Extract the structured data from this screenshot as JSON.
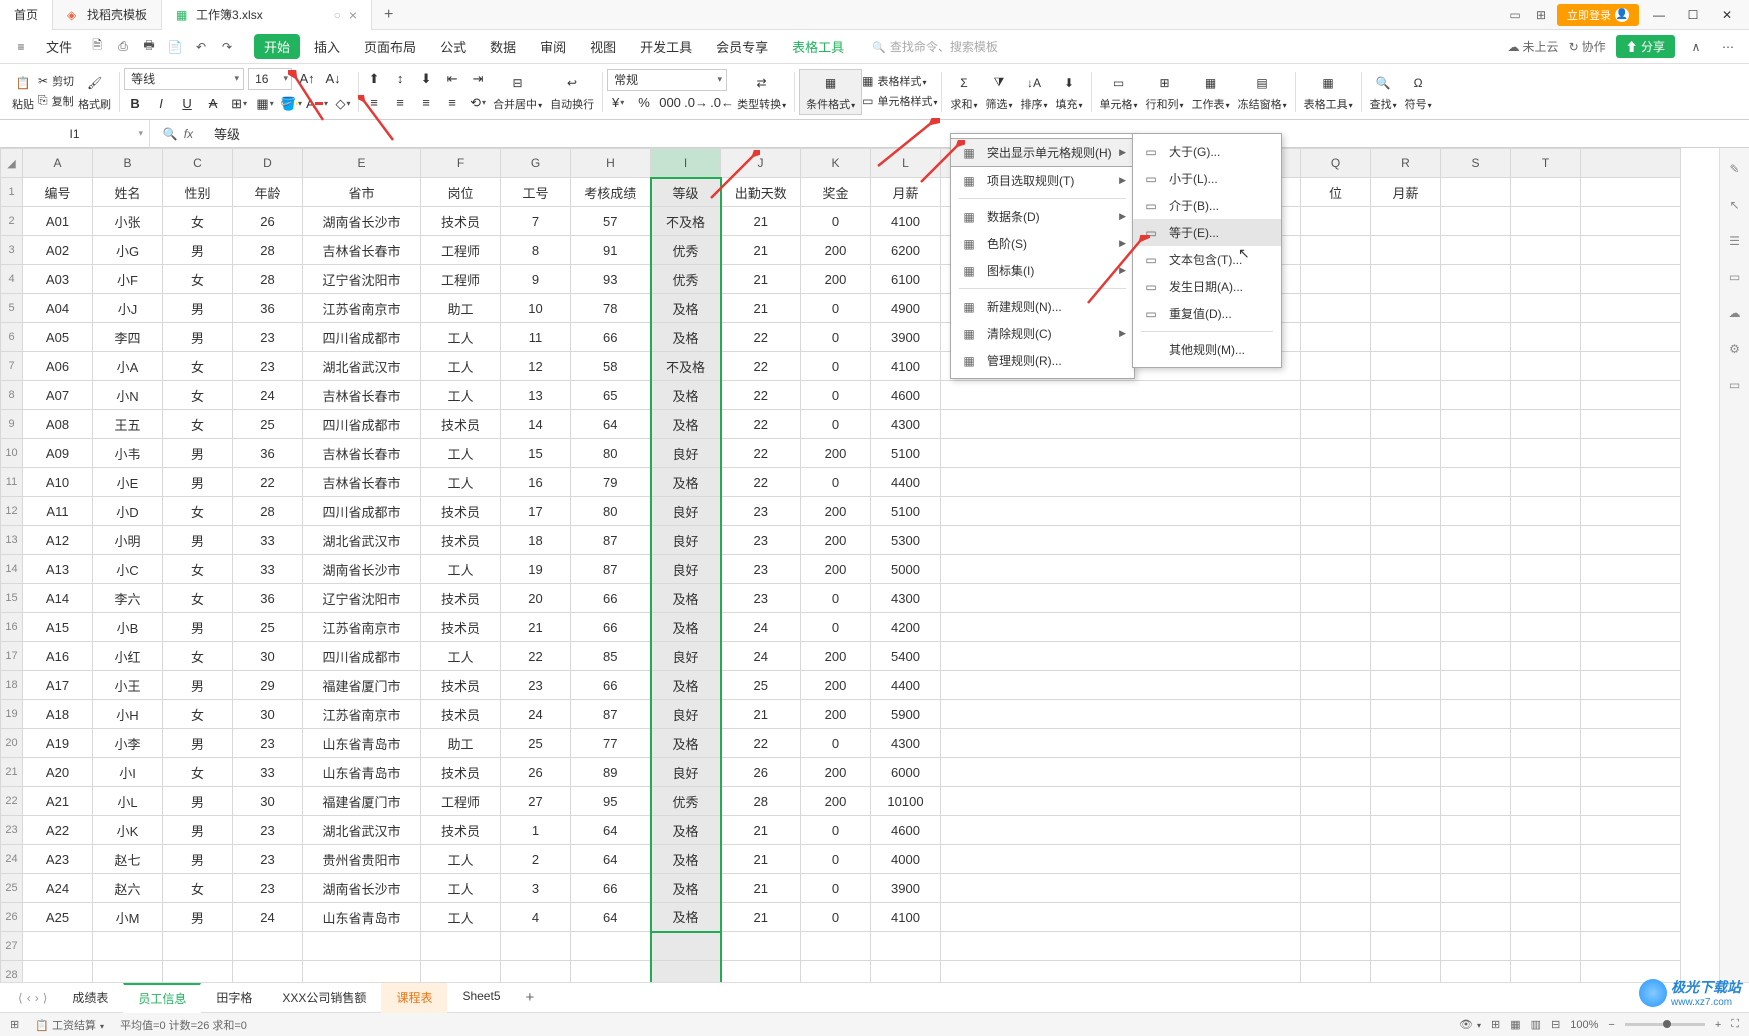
{
  "titlebar": {
    "tabs": [
      {
        "label": "首页",
        "icon": "home",
        "active": false
      },
      {
        "label": "找稻壳模板",
        "icon": "template",
        "active": false
      },
      {
        "label": "工作簿3.xlsx",
        "icon": "spreadsheet",
        "active": true
      }
    ],
    "login_label": "立即登录"
  },
  "menubar": {
    "file_label": "文件",
    "items": [
      "开始",
      "插入",
      "页面布局",
      "公式",
      "数据",
      "审阅",
      "视图",
      "开发工具",
      "会员专享",
      "表格工具"
    ],
    "active_index": 0,
    "search_placeholder": "查找命令、搜索模板",
    "cloud_label": "未上云",
    "coop_label": "协作",
    "share_label": "分享"
  },
  "ribbon": {
    "paste": "粘贴",
    "cut": "剪切",
    "copy": "复制",
    "format_painter": "格式刷",
    "font_name": "等线",
    "font_size": "16",
    "merge_center": "合并居中",
    "auto_wrap": "自动换行",
    "number_format": "常规",
    "type_convert": "类型转换",
    "cond_format": "条件格式",
    "table_style": "表格样式",
    "cell_style": "单元格样式",
    "sum": "求和",
    "filter": "筛选",
    "sort": "排序",
    "fill": "填充",
    "cell": "单元格",
    "rowcol": "行和列",
    "worksheet": "工作表",
    "freeze": "冻结窗格",
    "table_tools": "表格工具",
    "find": "查找",
    "symbol": "符号"
  },
  "formula_bar": {
    "name_box": "I1",
    "formula": "等级"
  },
  "column_headers": [
    "A",
    "B",
    "C",
    "D",
    "E",
    "F",
    "G",
    "H",
    "I",
    "J",
    "K",
    "L"
  ],
  "extra_col_headers": [
    "Q",
    "R",
    "S",
    "T"
  ],
  "header_row": [
    "编号",
    "姓名",
    "性别",
    "年龄",
    "省市",
    "岗位",
    "工号",
    "考核成绩",
    "等级",
    "出勤天数",
    "奖金",
    "月薪"
  ],
  "extra_header_cells": [
    "位",
    "月薪"
  ],
  "rows": [
    [
      "A01",
      "小张",
      "女",
      "26",
      "湖南省长沙市",
      "技术员",
      "7",
      "57",
      "不及格",
      "21",
      "0",
      "4100"
    ],
    [
      "A02",
      "小G",
      "男",
      "28",
      "吉林省长春市",
      "工程师",
      "8",
      "91",
      "优秀",
      "21",
      "200",
      "6200"
    ],
    [
      "A03",
      "小F",
      "女",
      "28",
      "辽宁省沈阳市",
      "工程师",
      "9",
      "93",
      "优秀",
      "21",
      "200",
      "6100"
    ],
    [
      "A04",
      "小J",
      "男",
      "36",
      "江苏省南京市",
      "助工",
      "10",
      "78",
      "及格",
      "21",
      "0",
      "4900"
    ],
    [
      "A05",
      "李四",
      "男",
      "23",
      "四川省成都市",
      "工人",
      "11",
      "66",
      "及格",
      "22",
      "0",
      "3900"
    ],
    [
      "A06",
      "小A",
      "女",
      "23",
      "湖北省武汉市",
      "工人",
      "12",
      "58",
      "不及格",
      "22",
      "0",
      "4100"
    ],
    [
      "A07",
      "小N",
      "女",
      "24",
      "吉林省长春市",
      "工人",
      "13",
      "65",
      "及格",
      "22",
      "0",
      "4600"
    ],
    [
      "A08",
      "王五",
      "女",
      "25",
      "四川省成都市",
      "技术员",
      "14",
      "64",
      "及格",
      "22",
      "0",
      "4300"
    ],
    [
      "A09",
      "小韦",
      "男",
      "36",
      "吉林省长春市",
      "工人",
      "15",
      "80",
      "良好",
      "22",
      "200",
      "5100"
    ],
    [
      "A10",
      "小E",
      "男",
      "22",
      "吉林省长春市",
      "工人",
      "16",
      "79",
      "及格",
      "22",
      "0",
      "4400"
    ],
    [
      "A11",
      "小D",
      "女",
      "28",
      "四川省成都市",
      "技术员",
      "17",
      "80",
      "良好",
      "23",
      "200",
      "5100"
    ],
    [
      "A12",
      "小明",
      "男",
      "33",
      "湖北省武汉市",
      "技术员",
      "18",
      "87",
      "良好",
      "23",
      "200",
      "5300"
    ],
    [
      "A13",
      "小C",
      "女",
      "33",
      "湖南省长沙市",
      "工人",
      "19",
      "87",
      "良好",
      "23",
      "200",
      "5000"
    ],
    [
      "A14",
      "李六",
      "女",
      "36",
      "辽宁省沈阳市",
      "技术员",
      "20",
      "66",
      "及格",
      "23",
      "0",
      "4300"
    ],
    [
      "A15",
      "小B",
      "男",
      "25",
      "江苏省南京市",
      "技术员",
      "21",
      "66",
      "及格",
      "24",
      "0",
      "4200"
    ],
    [
      "A16",
      "小红",
      "女",
      "30",
      "四川省成都市",
      "工人",
      "22",
      "85",
      "良好",
      "24",
      "200",
      "5400"
    ],
    [
      "A17",
      "小王",
      "男",
      "29",
      "福建省厦门市",
      "技术员",
      "23",
      "66",
      "及格",
      "25",
      "200",
      "4400"
    ],
    [
      "A18",
      "小H",
      "女",
      "30",
      "江苏省南京市",
      "技术员",
      "24",
      "87",
      "良好",
      "21",
      "200",
      "5900"
    ],
    [
      "A19",
      "小李",
      "男",
      "23",
      "山东省青岛市",
      "助工",
      "25",
      "77",
      "及格",
      "22",
      "0",
      "4300"
    ],
    [
      "A20",
      "小I",
      "女",
      "33",
      "山东省青岛市",
      "技术员",
      "26",
      "89",
      "良好",
      "26",
      "200",
      "6000"
    ],
    [
      "A21",
      "小L",
      "男",
      "30",
      "福建省厦门市",
      "工程师",
      "27",
      "95",
      "优秀",
      "28",
      "200",
      "10100"
    ],
    [
      "A22",
      "小K",
      "男",
      "23",
      "湖北省武汉市",
      "技术员",
      "1",
      "64",
      "及格",
      "21",
      "0",
      "4600"
    ],
    [
      "A23",
      "赵七",
      "男",
      "23",
      "贵州省贵阳市",
      "工人",
      "2",
      "64",
      "及格",
      "21",
      "0",
      "4000"
    ],
    [
      "A24",
      "赵六",
      "女",
      "23",
      "湖南省长沙市",
      "工人",
      "3",
      "66",
      "及格",
      "21",
      "0",
      "3900"
    ],
    [
      "A25",
      "小M",
      "男",
      "24",
      "山东省青岛市",
      "工人",
      "4",
      "64",
      "及格",
      "21",
      "0",
      "4100"
    ]
  ],
  "menu1": {
    "items": [
      {
        "icon": "highlight",
        "label": "突出显示单元格规则(H)",
        "arrow": true,
        "highlight": true
      },
      {
        "icon": "top",
        "label": "项目选取规则(T)",
        "arrow": true
      },
      {
        "icon": "databar",
        "label": "数据条(D)",
        "arrow": true
      },
      {
        "icon": "colorscale",
        "label": "色阶(S)",
        "arrow": true
      },
      {
        "icon": "iconset",
        "label": "图标集(I)",
        "arrow": true
      },
      {
        "icon": "newrule",
        "label": "新建规则(N)..."
      },
      {
        "icon": "clear",
        "label": "清除规则(C)",
        "arrow": true
      },
      {
        "icon": "manage",
        "label": "管理规则(R)..."
      }
    ]
  },
  "menu2": {
    "items": [
      {
        "icon": "gt",
        "label": "大于(G)..."
      },
      {
        "icon": "lt",
        "label": "小于(L)..."
      },
      {
        "icon": "between",
        "label": "介于(B)..."
      },
      {
        "icon": "eq",
        "label": "等于(E)...",
        "highlight": true
      },
      {
        "icon": "contains",
        "label": "文本包含(T)..."
      },
      {
        "icon": "date",
        "label": "发生日期(A)..."
      },
      {
        "icon": "dup",
        "label": "重复值(D)..."
      }
    ],
    "other": "其他规则(M)..."
  },
  "sheet_tabs": {
    "tabs": [
      {
        "label": "成绩表"
      },
      {
        "label": "员工信息",
        "active": true
      },
      {
        "label": "田字格"
      },
      {
        "label": "XXX公司销售额"
      },
      {
        "label": "课程表",
        "orange": true
      },
      {
        "label": "Sheet5"
      }
    ]
  },
  "status_bar": {
    "label1": "工资结算",
    "stats": "平均值=0  计数=26  求和=0",
    "zoom": "100%"
  },
  "watermark": {
    "text": "极光下载站",
    "sub": "www.xz7.com"
  }
}
